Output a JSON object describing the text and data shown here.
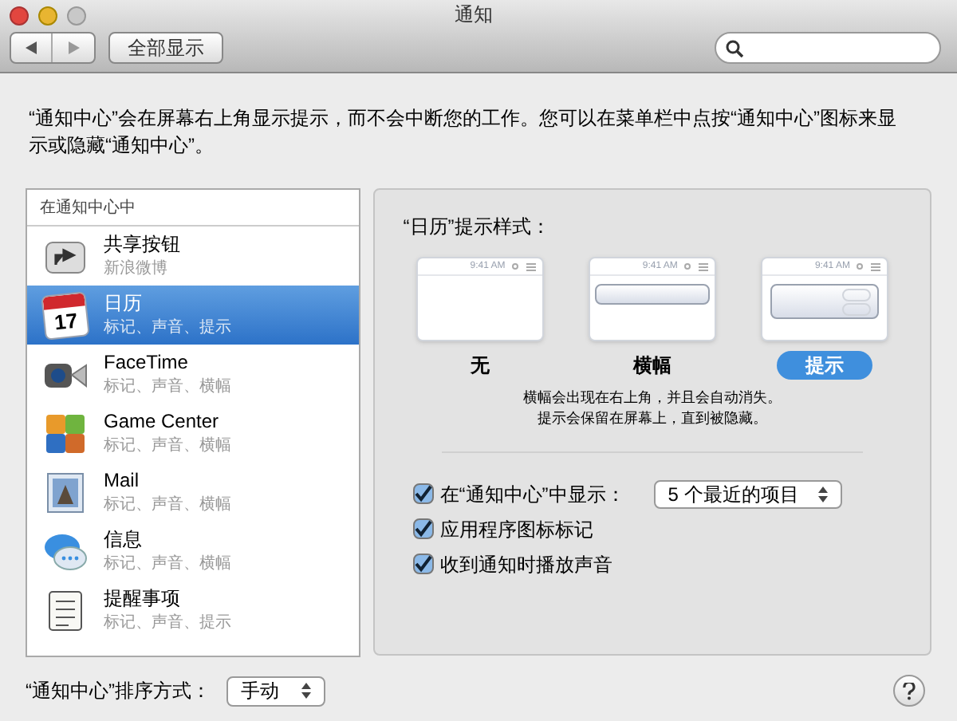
{
  "window": {
    "title": "通知"
  },
  "toolbar": {
    "show_all": "全部显示"
  },
  "description": "“通知中心”会在屏幕右上角显示提示，而不会中断您的工作。您可以在菜单栏中点按“通知中心”图标来显示或隐藏“通知中心”。",
  "sidebar": {
    "header": "在通知中心中",
    "items": [
      {
        "kind": "share",
        "name": "共享按钮",
        "detail": "新浪微博",
        "selected": false
      },
      {
        "kind": "calendar",
        "name": "日历",
        "detail": "标记、声音、提示",
        "selected": true,
        "icon_text": "17"
      },
      {
        "kind": "facetime",
        "name": "FaceTime",
        "detail": "标记、声音、横幅",
        "selected": false
      },
      {
        "kind": "gamecenter",
        "name": "Game Center",
        "detail": "标记、声音、横幅",
        "selected": false
      },
      {
        "kind": "mail",
        "name": "Mail",
        "detail": "标记、声音、横幅",
        "selected": false
      },
      {
        "kind": "messages",
        "name": "信息",
        "detail": "标记、声音、横幅",
        "selected": false
      },
      {
        "kind": "reminders",
        "name": "提醒事项",
        "detail": "标记、声音、提示",
        "selected": false
      }
    ]
  },
  "panel": {
    "heading": "“日历”提示样式：",
    "styles": [
      {
        "kind": "none",
        "label": "无",
        "clock": "9:41 AM",
        "selected": false
      },
      {
        "kind": "banner",
        "label": "横幅",
        "clock": "9:41 AM",
        "selected": false
      },
      {
        "kind": "alert",
        "label": "提示",
        "clock": "9:41 AM",
        "selected": true
      }
    ],
    "note": [
      "横幅会出现在右上角，并且会自动消失。",
      "提示会保留在屏幕上，直到被隐藏。"
    ],
    "options": [
      {
        "label": "在“通知中心”中显示：",
        "checked": true,
        "popup": "5 个最近的项目"
      },
      {
        "label": "应用程序图标标记",
        "checked": true
      },
      {
        "label": "收到通知时播放声音",
        "checked": true
      }
    ]
  },
  "footer": {
    "sort_label": "“通知中心”排序方式：",
    "sort_value": "手动"
  }
}
